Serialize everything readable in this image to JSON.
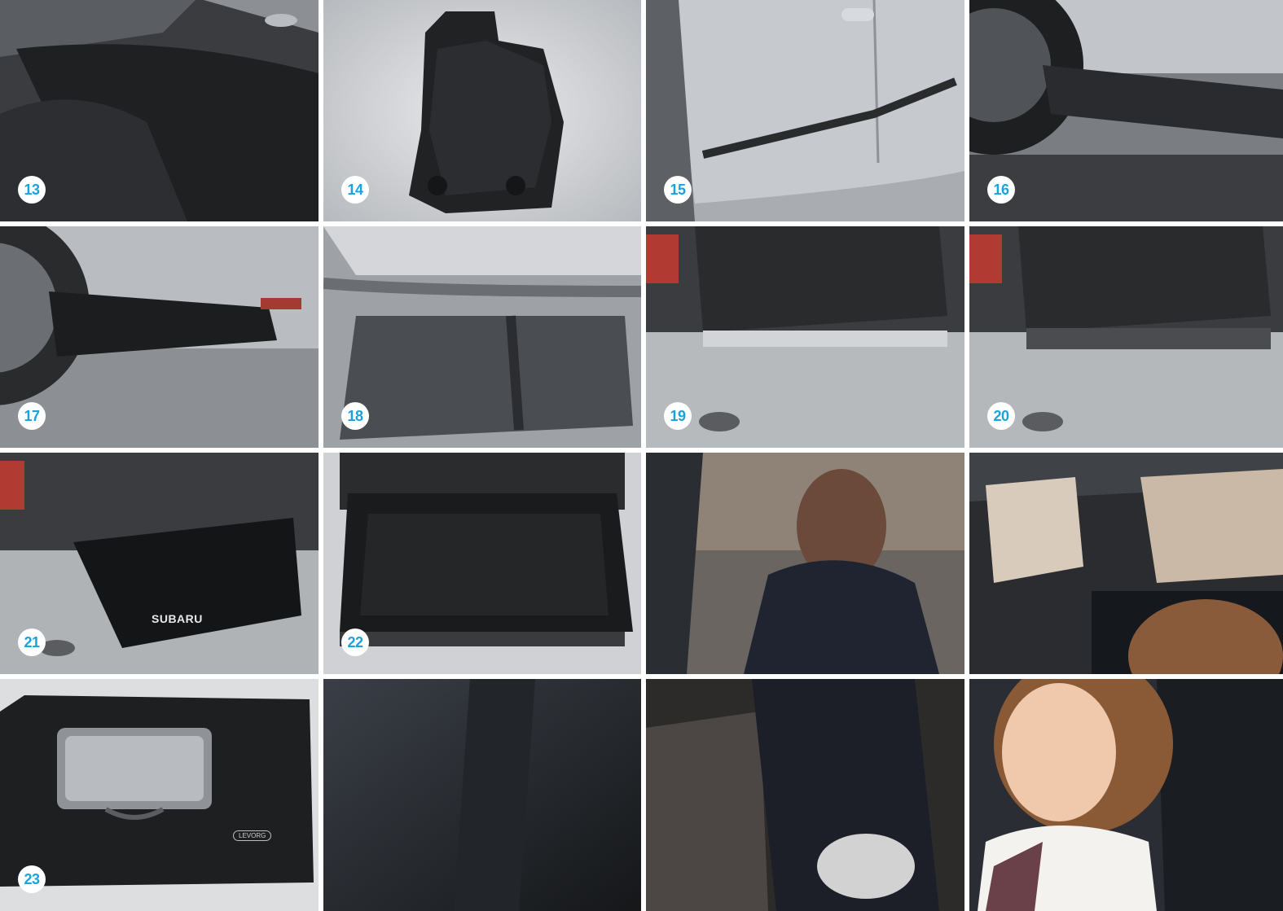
{
  "tiles": {
    "t13": {
      "badge": "13"
    },
    "t14": {
      "badge": "14"
    },
    "t15": {
      "badge": "15"
    },
    "t16": {
      "badge": "16"
    },
    "t17": {
      "badge": "17"
    },
    "t18": {
      "badge": "18"
    },
    "t19": {
      "badge": "19"
    },
    "t20": {
      "badge": "20"
    },
    "t21": {
      "badge": "21",
      "logo": "SUBARU"
    },
    "t22": {
      "badge": "22"
    },
    "t23": {
      "badge": "23",
      "mat_label": "LEVORG"
    }
  },
  "colors": {
    "badge_text": "#19a3dc",
    "badge_bg": "#ffffff",
    "divider": "#ffffff"
  }
}
